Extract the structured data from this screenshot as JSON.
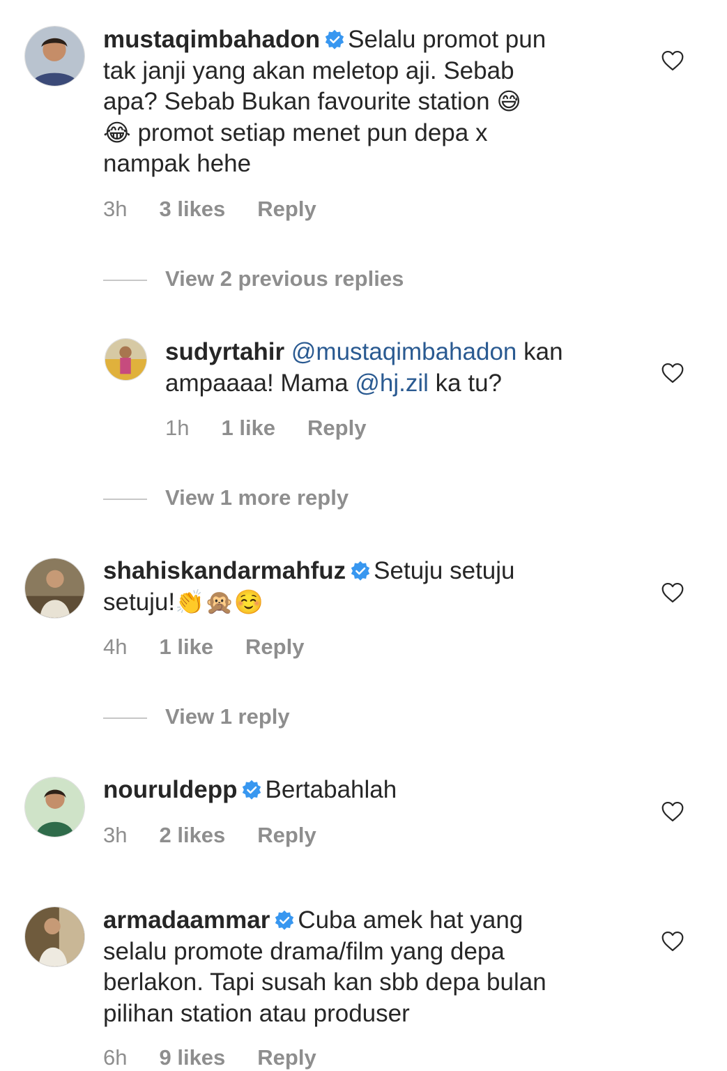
{
  "comments": [
    {
      "username": "mustaqimbahadon",
      "verified": true,
      "text_line1": "Selalu promot pun",
      "text_line2": "tak janji yang akan meletop aji. Sebab",
      "text_line3": "apa? Sebab Bukan favourite station",
      "emoji_sweat": "😅",
      "emoji_laugh": "😂",
      "text_line4": "promot setiap menet pun depa x",
      "text_line5": "nampak hehe",
      "time": "3h",
      "likes": "3 likes",
      "reply_label": "Reply"
    },
    {
      "username": "sudyrtahir",
      "mention1": "@mustaqimbahadon",
      "text_a": "kan",
      "text_b": "ampaaaa! Mama",
      "mention2": "@hj.zil",
      "text_c": "ka tu?",
      "time": "1h",
      "likes": "1 like",
      "reply_label": "Reply"
    },
    {
      "username": "shahiskandarmahfuz",
      "verified": true,
      "text_line1": "Setuju setuju",
      "text_line2": "setuju!",
      "emojis": "👏🙊☺️",
      "time": "4h",
      "likes": "1 like",
      "reply_label": "Reply"
    },
    {
      "username": "nouruldepp",
      "verified": true,
      "text_line1": "Bertabahlah",
      "time": "3h",
      "likes": "2 likes",
      "reply_label": "Reply"
    },
    {
      "username": "armadaammar",
      "verified": true,
      "text_line1": "Cuba amek hat yang",
      "text_line2": "selalu promote drama/film yang depa",
      "text_line3": "berlakon. Tapi susah kan sbb depa bulan",
      "text_line4": "pilihan station atau produser",
      "time": "6h",
      "likes": "9 likes",
      "reply_label": "Reply"
    }
  ],
  "thread_links": {
    "previous_replies": "View 2 previous replies",
    "more_reply": "View 1 more reply",
    "one_reply": "View 1 reply"
  },
  "icons": {
    "verified": "verified-badge-icon",
    "like": "heart-outline-icon"
  },
  "colors": {
    "text": "#262626",
    "secondary": "#8e8e8e",
    "mention": "#2a5a91",
    "verified": "#3897f0"
  }
}
